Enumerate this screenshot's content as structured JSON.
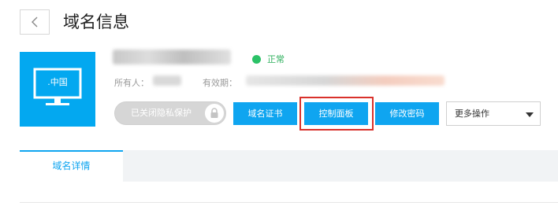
{
  "header": {
    "title": "域名信息"
  },
  "domain": {
    "tld_label": ".中国",
    "status": "正常",
    "status_color": "#2bc267",
    "owner_label": "所有人：",
    "expiry_label": "有效期："
  },
  "actions": {
    "privacy_label": "已关闭隐私保护",
    "cert_label": "域名证书",
    "panel_label": "控制面板",
    "password_label": "修改密码",
    "more_label": "更多操作"
  },
  "tabs": [
    {
      "label": "域名详情",
      "active": true
    }
  ],
  "colors": {
    "accent": "#0fa5f0",
    "highlight": "#d9312b",
    "card": "#03a8f0"
  }
}
